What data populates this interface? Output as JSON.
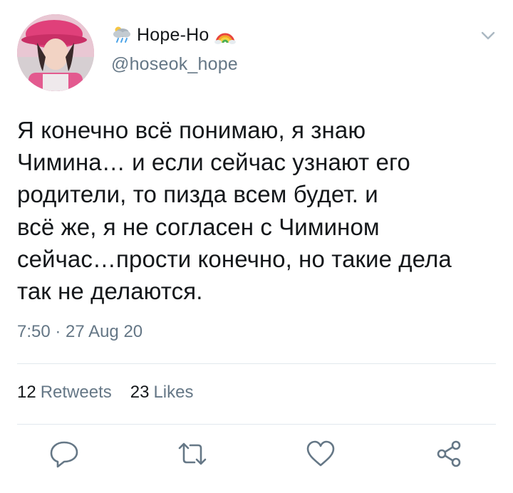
{
  "author": {
    "display_name": "Hope-Ho",
    "handle": "@hoseok_hope",
    "name_prefix_icon": "cloud-rain-icon",
    "name_suffix_icon": "rainbow-icon"
  },
  "tweet": {
    "text": "Я конечно всё понимаю, я знаю\nЧимина… и если сейчас узнают его\nродители, то пизда всем будет. и\nвсё же, я не согласен с Чимином\nсейчас…прости конечно, но такие дела\nтак не делаются.",
    "timestamp": "7:50 · 27 Aug 20"
  },
  "stats": {
    "retweets_count": "12",
    "retweets_label": "Retweets",
    "likes_count": "23",
    "likes_label": "Likes"
  },
  "actions": [
    "reply-icon",
    "retweet-icon",
    "like-icon",
    "share-icon"
  ],
  "colors": {
    "text": "#14171a",
    "secondary": "#657786",
    "divider": "#e1e8ed",
    "icon": "#657786"
  }
}
